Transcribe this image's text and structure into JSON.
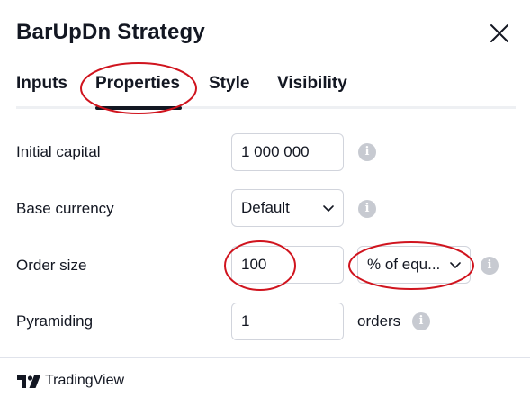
{
  "dialog": {
    "title": "BarUpDn Strategy"
  },
  "tabs": [
    {
      "label": "Inputs",
      "active": false
    },
    {
      "label": "Properties",
      "active": true
    },
    {
      "label": "Style",
      "active": false
    },
    {
      "label": "Visibility",
      "active": false
    }
  ],
  "properties": {
    "initial_capital": {
      "label": "Initial capital",
      "value": "1 000 000"
    },
    "base_currency": {
      "label": "Base currency",
      "value": "Default"
    },
    "order_size": {
      "label": "Order size",
      "value": "100",
      "unit_value": "% of equ..."
    },
    "pyramiding": {
      "label": "Pyramiding",
      "value": "1",
      "unit": "orders"
    }
  },
  "info_icon_glyph": "i",
  "footer": {
    "brand": "TradingView"
  },
  "colors": {
    "text": "#131722",
    "annotation": "#d0141e",
    "info_icon": "#c7cad1",
    "border": "#d1d4dc"
  }
}
